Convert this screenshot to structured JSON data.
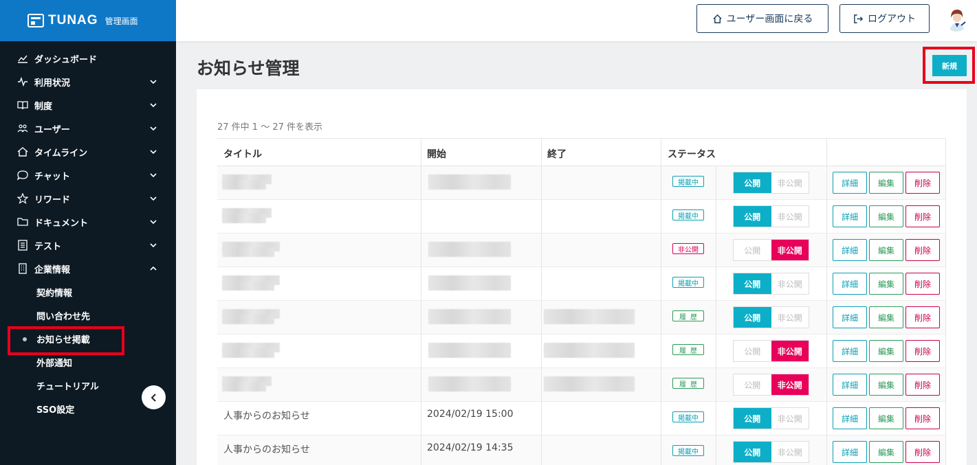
{
  "brand": {
    "name": "TUNAG",
    "sub": "管理画面"
  },
  "sidebar": {
    "items": [
      {
        "label": "ダッシュボード",
        "icon": "chart-icon",
        "expandable": false
      },
      {
        "label": "利用状況",
        "icon": "pulse-icon",
        "expandable": true
      },
      {
        "label": "制度",
        "icon": "book-icon",
        "expandable": true
      },
      {
        "label": "ユーザー",
        "icon": "users-icon",
        "expandable": true
      },
      {
        "label": "タイムライン",
        "icon": "home-icon",
        "expandable": true
      },
      {
        "label": "チャット",
        "icon": "chat-icon",
        "expandable": true
      },
      {
        "label": "リワード",
        "icon": "star-icon",
        "expandable": true
      },
      {
        "label": "ドキュメント",
        "icon": "folder-icon",
        "expandable": true
      },
      {
        "label": "テスト",
        "icon": "list-icon",
        "expandable": true
      },
      {
        "label": "企業情報",
        "icon": "building-icon",
        "expandable": true,
        "expanded": true
      }
    ],
    "sub_items": [
      {
        "label": "契約情報"
      },
      {
        "label": "問い合わせ先"
      },
      {
        "label": "お知らせ掲載",
        "active": true
      },
      {
        "label": "外部通知"
      },
      {
        "label": "チュートリアル"
      },
      {
        "label": "SSO設定"
      }
    ]
  },
  "header": {
    "back_label": "ユーザー画面に戻る",
    "logout_label": "ログアウト"
  },
  "page": {
    "title": "お知らせ管理",
    "new_label": "新規",
    "count_text": "27 件中 1 〜 27 件を表示"
  },
  "table": {
    "columns": [
      "タイトル",
      "開始",
      "終了",
      "ステータス"
    ],
    "actions": {
      "detail": "詳細",
      "edit": "編集",
      "delete": "削除"
    },
    "toggle": {
      "public": "公開",
      "private": "非公開"
    },
    "rows": [
      {
        "title": "",
        "start": "",
        "end": "",
        "status": "掲載中",
        "status_kind": "live",
        "published": true,
        "blur_title": [
          72,
          20
        ],
        "blur_start": true,
        "blur_end": false
      },
      {
        "title": "",
        "start": "",
        "end": "",
        "status": "掲載中",
        "status_kind": "live",
        "published": true,
        "blur_title": [
          72,
          20
        ],
        "blur_start": false,
        "blur_end": false
      },
      {
        "title": "",
        "start": "",
        "end": "",
        "status": "非公開",
        "status_kind": "priv",
        "published": false,
        "blur_title": [
          84,
          20
        ],
        "blur_start": true,
        "blur_end": false
      },
      {
        "title": "",
        "start": "",
        "end": "",
        "status": "掲載中",
        "status_kind": "live",
        "published": true,
        "blur_title": [
          84,
          20
        ],
        "blur_start": true,
        "blur_end": false
      },
      {
        "title": "",
        "start": "",
        "end": "",
        "status": "履歴",
        "status_kind": "hist",
        "published": true,
        "blur_title": [
          84,
          20
        ],
        "blur_start": true,
        "blur_end": true
      },
      {
        "title": "",
        "start": "",
        "end": "",
        "status": "履歴",
        "status_kind": "hist",
        "published": false,
        "blur_title": [
          84,
          20
        ],
        "blur_start": true,
        "blur_end": true
      },
      {
        "title": "",
        "start": "",
        "end": "",
        "status": "履歴",
        "status_kind": "hist",
        "published": false,
        "blur_title": [
          72,
          20
        ],
        "blur_start": true,
        "blur_end": true
      },
      {
        "title": "人事からのお知らせ",
        "start": "2024/02/19 15:00",
        "end": "",
        "status": "掲載中",
        "status_kind": "live",
        "published": true
      },
      {
        "title": "人事からのお知らせ",
        "start": "2024/02/19 14:35",
        "end": "",
        "status": "掲載中",
        "status_kind": "live",
        "published": true
      }
    ]
  },
  "colors": {
    "accent": "#0cafc7",
    "brand": "#0e78c7",
    "sidebar": "#0d1a24",
    "danger": "#e8005a",
    "highlight": "#e8001c"
  }
}
